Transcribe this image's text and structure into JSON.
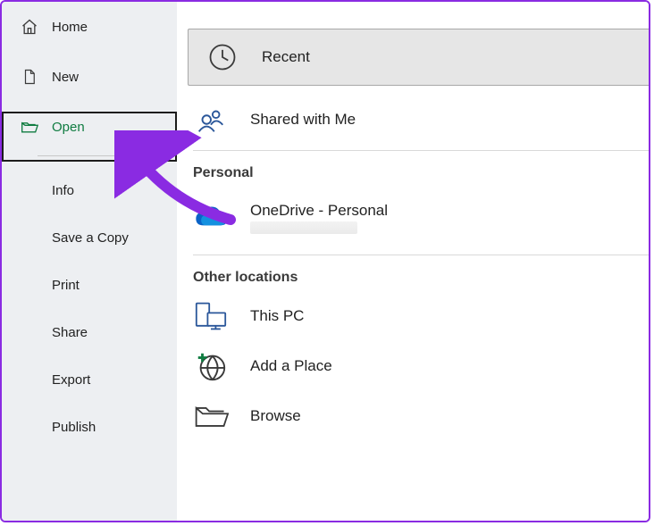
{
  "sidebar": {
    "items": [
      {
        "label": "Home",
        "icon": "home-icon"
      },
      {
        "label": "New",
        "icon": "new-doc-icon"
      },
      {
        "label": "Open",
        "icon": "open-folder-icon",
        "selected": true
      }
    ],
    "sub_items": [
      {
        "label": "Info"
      },
      {
        "label": "Save a Copy"
      },
      {
        "label": "Print"
      },
      {
        "label": "Share"
      },
      {
        "label": "Export"
      },
      {
        "label": "Publish"
      }
    ]
  },
  "main": {
    "recent": {
      "label": "Recent"
    },
    "shared_with_me": {
      "label": "Shared with Me"
    },
    "sections": {
      "personal": "Personal",
      "other": "Other locations"
    },
    "onedrive": {
      "label": "OneDrive - Personal"
    },
    "this_pc": {
      "label": "This PC"
    },
    "add_place": {
      "label": "Add a Place"
    },
    "browse": {
      "label": "Browse"
    }
  },
  "annotation": {
    "arrow_color": "#8a2be2"
  }
}
